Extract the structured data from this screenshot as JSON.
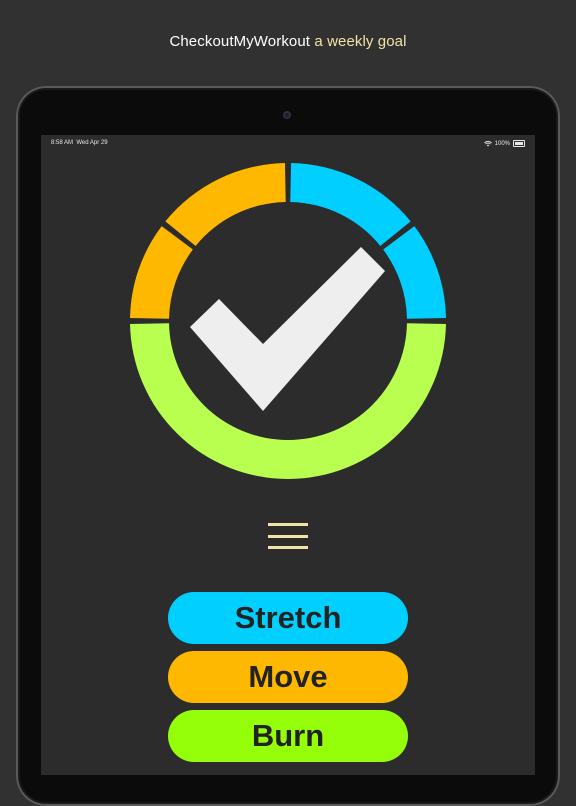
{
  "caption": {
    "app": "CheckoutMyWorkout",
    "tagline": "a weekly goal"
  },
  "status_bar": {
    "time": "8:58 AM",
    "date": "Wed Apr 29",
    "battery": "100%"
  },
  "ring": {
    "colors": {
      "stretch": "#00cfff",
      "move": "#ffb800",
      "burn": "#b8ff50",
      "check": "#eeeeee"
    }
  },
  "buttons": {
    "stretch": "Stretch",
    "move": "Move",
    "burn": "Burn"
  },
  "colors": {
    "caption_accent": "#f1e3a6",
    "menu": "#f1e3a6"
  }
}
